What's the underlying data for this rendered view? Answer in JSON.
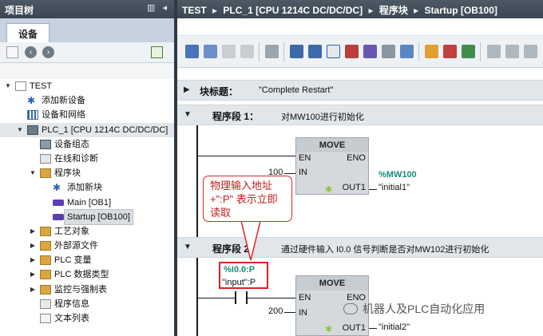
{
  "left_panel": {
    "title": "项目树",
    "ctrl_glyphs": "▥ ◂",
    "tab": "设备",
    "tree": [
      {
        "label": "TEST",
        "icon": "project-icon"
      },
      {
        "label": "添加新设备",
        "icon": "add-device-icon"
      },
      {
        "label": "设备和网络",
        "icon": "network-icon"
      },
      {
        "label": "PLC_1 [CPU 1214C DC/DC/DC]",
        "icon": "cpu-icon"
      },
      {
        "label": "设备组态",
        "icon": "device-config-icon"
      },
      {
        "label": "在线和诊断",
        "icon": "online-diagnostics-icon"
      },
      {
        "label": "程序块",
        "icon": "folder-icon"
      },
      {
        "label": "添加新块",
        "icon": "add-block-icon"
      },
      {
        "label": "Main [OB1]",
        "icon": "ob-block-icon"
      },
      {
        "label": "Startup [OB100]",
        "icon": "ob-block-icon"
      },
      {
        "label": "工艺对象",
        "icon": "folder-icon"
      },
      {
        "label": "外部源文件",
        "icon": "folder-icon"
      },
      {
        "label": "PLC 变量",
        "icon": "folder-icon"
      },
      {
        "label": "PLC 数据类型",
        "icon": "folder-icon"
      },
      {
        "label": "监控与强制表",
        "icon": "folder-icon"
      },
      {
        "label": "程序信息",
        "icon": "program-info-icon"
      },
      {
        "label": "文本列表",
        "icon": "text-list-icon"
      }
    ]
  },
  "breadcrumb": {
    "sep": "▸",
    "items": [
      "TEST",
      "PLC_1 [CPU 1214C DC/DC/DC]",
      "程序块",
      "Startup [OB100]"
    ]
  },
  "editor": {
    "block_title": {
      "key": "块标题：",
      "value": "\"Complete Restart\""
    },
    "network1": {
      "key": "程序段 1：",
      "comment": "对MW100进行初始化",
      "box": "MOVE",
      "en": "EN",
      "eno": "ENO",
      "in": "IN",
      "out": "OUT1",
      "in_value": "100",
      "out_addr": "%MW100",
      "out_tag": "\"initial1\""
    },
    "network2": {
      "key": "程序段 2：",
      "comment": "通过硬件输入 I0.0 信号判断是否对MW102进行初始化",
      "contact_addr": "%I0.0:P",
      "contact_tag": "\"input\":P",
      "box": "MOVE",
      "en": "EN",
      "eno": "ENO",
      "in": "IN",
      "out": "OUT1",
      "in_value": "200",
      "out_tag": "\"initial2\""
    }
  },
  "annotation": {
    "text": "物理输入地址+\":P\" 表示立即读取"
  },
  "watermark": "机器人及PLC自动化应用",
  "colors": {
    "header_bar": "#3a4652",
    "address_teal": "#1b8a7a",
    "annotation_red": "#d22222"
  }
}
